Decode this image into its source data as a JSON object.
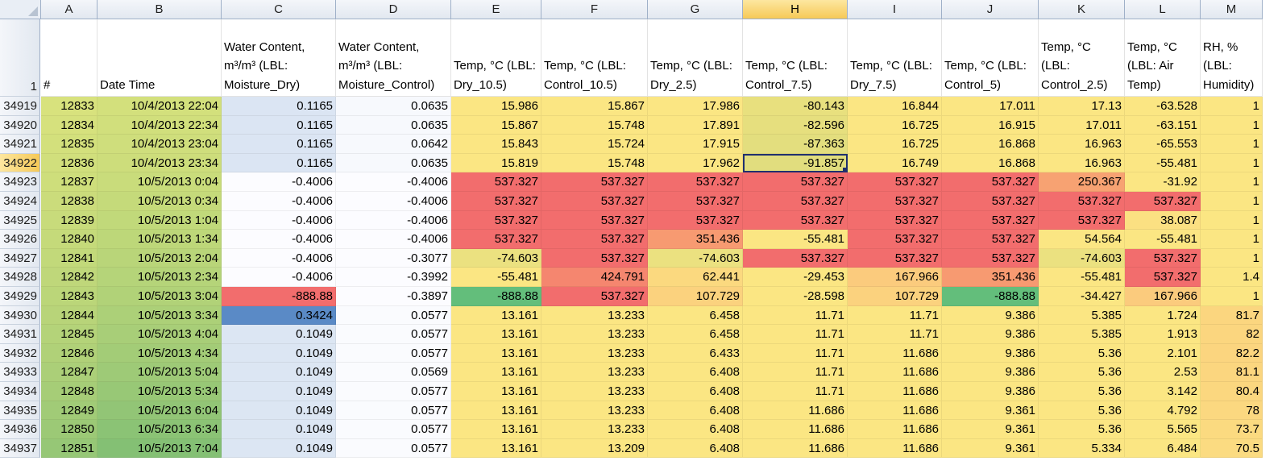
{
  "sheet": {
    "columns": [
      "A",
      "B",
      "C",
      "D",
      "E",
      "F",
      "G",
      "H",
      "I",
      "J",
      "K",
      "L",
      "M"
    ],
    "selected_column": "H",
    "selected_row": "34922",
    "header_row": {
      "row_label": "1",
      "labels": [
        "#",
        "Date Time",
        "Water Content,\nm³/m³ (LBL:\nMoisture_Dry)",
        "Water Content,\nm³/m³ (LBL:\nMoisture_Control)",
        "Temp, °C (LBL:\nDry_10.5)",
        "Temp, °C (LBL:\nControl_10.5)",
        "Temp, °C (LBL:\nDry_2.5)",
        "Temp, °C (LBL:\nControl_7.5)",
        "Temp, °C (LBL:\nDry_7.5)",
        "Temp, °C (LBL:\nControl_5)",
        "Temp, °C\n(LBL:\nControl_2.5)",
        "Temp, °C\n(LBL: Air\nTemp)",
        "RH, %\n(LBL:\nHumidity)"
      ]
    },
    "rows": [
      {
        "label": "34919",
        "cells": [
          "12833",
          "10/4/2013 22:04",
          "0.1165",
          "0.0635",
          "15.986",
          "15.867",
          "17.986",
          "-80.143",
          "16.844",
          "17.011",
          "17.13",
          "-63.528",
          "1"
        ],
        "colors": [
          "#d8e27d",
          "#d3e07c",
          "#dbe5f3",
          "#f7f9fd",
          "#fbe683",
          "#fbe683",
          "#fbe683",
          "#e8e07e",
          "#fbe683",
          "#fbe683",
          "#fbe683",
          "#fbe683",
          "#fbe683"
        ]
      },
      {
        "label": "34920",
        "cells": [
          "12834",
          "10/4/2013 22:34",
          "0.1165",
          "0.0635",
          "15.867",
          "15.748",
          "17.891",
          "-82.596",
          "16.725",
          "16.915",
          "17.011",
          "-63.151",
          "1"
        ],
        "colors": [
          "#d6e17d",
          "#d1df7c",
          "#dbe5f3",
          "#f7f9fd",
          "#fbe683",
          "#fbe683",
          "#fbe683",
          "#e6df7e",
          "#fbe683",
          "#fbe683",
          "#fbe683",
          "#fbe683",
          "#fbe683"
        ]
      },
      {
        "label": "34921",
        "cells": [
          "12835",
          "10/4/2013 23:04",
          "0.1165",
          "0.0642",
          "15.843",
          "15.724",
          "17.915",
          "-87.363",
          "16.725",
          "16.868",
          "16.963",
          "-65.553",
          "1"
        ],
        "colors": [
          "#d3e07c",
          "#cfde7c",
          "#dbe5f3",
          "#f7f9fd",
          "#fbe683",
          "#fbe683",
          "#fbe683",
          "#e3de7e",
          "#fbe683",
          "#fbe683",
          "#fbe683",
          "#fbe683",
          "#fbe683"
        ]
      },
      {
        "label": "34922",
        "cells": [
          "12836",
          "10/4/2013 23:34",
          "0.1165",
          "0.0635",
          "15.819",
          "15.748",
          "17.962",
          "-91.857",
          "16.749",
          "16.868",
          "16.963",
          "-55.481",
          "1"
        ],
        "colors": [
          "#d1df7c",
          "#cddd7b",
          "#dbe5f3",
          "#f7f9fd",
          "#fbe683",
          "#fbe683",
          "#fbe683",
          "#e1dd7e",
          "#fbe683",
          "#fbe683",
          "#fbe683",
          "#fbe683",
          "#fbe683"
        ]
      },
      {
        "label": "34923",
        "cells": [
          "12837",
          "10/5/2013 0:04",
          "-0.4006",
          "-0.4006",
          "537.327",
          "537.327",
          "537.327",
          "537.327",
          "537.327",
          "537.327",
          "250.367",
          "-31.92",
          "1"
        ],
        "colors": [
          "#cede7b",
          "#c9dc7b",
          "#fcfcff",
          "#fcfcff",
          "#f26d6d",
          "#f26d6d",
          "#f26d6d",
          "#f26d6d",
          "#f26d6d",
          "#f26d6d",
          "#f7a272",
          "#fbe683",
          "#fbe683"
        ]
      },
      {
        "label": "34924",
        "cells": [
          "12838",
          "10/5/2013 0:34",
          "-0.4006",
          "-0.4006",
          "537.327",
          "537.327",
          "537.327",
          "537.327",
          "537.327",
          "537.327",
          "537.327",
          "537.327",
          "1"
        ],
        "colors": [
          "#cbdc7b",
          "#c5da7a",
          "#fcfcff",
          "#fcfcff",
          "#f26d6d",
          "#f26d6d",
          "#f26d6d",
          "#f26d6d",
          "#f26d6d",
          "#f26d6d",
          "#f26d6d",
          "#f26d6d",
          "#fbe683"
        ]
      },
      {
        "label": "34925",
        "cells": [
          "12839",
          "10/5/2013 1:04",
          "-0.4006",
          "-0.4006",
          "537.327",
          "537.327",
          "537.327",
          "537.327",
          "537.327",
          "537.327",
          "537.327",
          "38.087",
          "1"
        ],
        "colors": [
          "#c8db7b",
          "#c1d97a",
          "#fcfcff",
          "#fcfcff",
          "#f26d6d",
          "#f26d6d",
          "#f26d6d",
          "#f26d6d",
          "#f26d6d",
          "#f26d6d",
          "#f26d6d",
          "#fbe082",
          "#fbe683"
        ]
      },
      {
        "label": "34926",
        "cells": [
          "12840",
          "10/5/2013 1:34",
          "-0.4006",
          "-0.4006",
          "537.327",
          "537.327",
          "351.436",
          "-55.481",
          "537.327",
          "537.327",
          "54.564",
          "-55.481",
          "1"
        ],
        "colors": [
          "#c5da7a",
          "#bdd779",
          "#fcfcff",
          "#fcfcff",
          "#f26d6d",
          "#f26d6d",
          "#f79a71",
          "#fbe683",
          "#f26d6d",
          "#f26d6d",
          "#fbe683",
          "#fbe683",
          "#fbe683"
        ]
      },
      {
        "label": "34927",
        "cells": [
          "12841",
          "10/5/2013 2:04",
          "-0.4006",
          "-0.3077",
          "-74.603",
          "537.327",
          "-74.603",
          "537.327",
          "537.327",
          "537.327",
          "-74.603",
          "537.327",
          "1"
        ],
        "colors": [
          "#c2d97a",
          "#b9d579",
          "#fcfcff",
          "#fcfcff",
          "#ebe180",
          "#f26d6d",
          "#ebe180",
          "#f26d6d",
          "#f26d6d",
          "#f26d6d",
          "#ebe180",
          "#f26d6d",
          "#fbe683"
        ]
      },
      {
        "label": "34928",
        "cells": [
          "12842",
          "10/5/2013 2:34",
          "-0.4006",
          "-0.3992",
          "-55.481",
          "424.791",
          "62.441",
          "-29.453",
          "167.966",
          "351.436",
          "-55.481",
          "537.327",
          "1.4"
        ],
        "colors": [
          "#bfd77a",
          "#b5d479",
          "#fcfcff",
          "#fcfcff",
          "#fbe683",
          "#f5866f",
          "#fbd97f",
          "#fbe683",
          "#fbcb7d",
          "#f79a71",
          "#fbe683",
          "#f26d6d",
          "#fbe683"
        ]
      },
      {
        "label": "34929",
        "cells": [
          "12843",
          "10/5/2013 3:04",
          "-888.88",
          "-0.3897",
          "-888.88",
          "537.327",
          "107.729",
          "-28.598",
          "107.729",
          "-888.88",
          "-34.427",
          "167.966",
          "1"
        ],
        "colors": [
          "#bbd679",
          "#b1d278",
          "#f26d6d",
          "#fcfcff",
          "#63be7b",
          "#f26d6d",
          "#fbd27e",
          "#fbe683",
          "#fbd27e",
          "#63be7b",
          "#fbe683",
          "#fbcb7d",
          "#fbe683"
        ]
      },
      {
        "label": "34930",
        "cells": [
          "12844",
          "10/5/2013 3:34",
          "0.3424",
          "0.0577",
          "13.161",
          "13.233",
          "6.458",
          "11.71",
          "11.71",
          "9.386",
          "5.385",
          "1.724",
          "81.7"
        ],
        "colors": [
          "#b8d479",
          "#acd078",
          "#5a8ac6",
          "#fafbfe",
          "#fbe683",
          "#fbe683",
          "#fbe683",
          "#fbe683",
          "#fbe683",
          "#fbe683",
          "#fbe683",
          "#fbe683",
          "#fbd67f"
        ]
      },
      {
        "label": "34931",
        "cells": [
          "12845",
          "10/5/2013 4:04",
          "0.1049",
          "0.0577",
          "13.161",
          "13.233",
          "6.458",
          "11.71",
          "11.71",
          "9.386",
          "5.385",
          "1.913",
          "82"
        ],
        "colors": [
          "#b4d379",
          "#a8ce78",
          "#dce6f3",
          "#fafbfe",
          "#fbe683",
          "#fbe683",
          "#fbe683",
          "#fbe683",
          "#fbe683",
          "#fbe683",
          "#fbe683",
          "#fbe683",
          "#fbd67f"
        ]
      },
      {
        "label": "34932",
        "cells": [
          "12846",
          "10/5/2013 4:34",
          "0.1049",
          "0.0577",
          "13.161",
          "13.233",
          "6.433",
          "11.71",
          "11.686",
          "9.386",
          "5.36",
          "2.101",
          "82.2"
        ],
        "colors": [
          "#b0d178",
          "#a3cc77",
          "#dce6f3",
          "#fafbfe",
          "#fbe683",
          "#fbe683",
          "#fbe683",
          "#fbe683",
          "#fbe683",
          "#fbe683",
          "#fbe683",
          "#fbe683",
          "#fbd57f"
        ]
      },
      {
        "label": "34933",
        "cells": [
          "12847",
          "10/5/2013 5:04",
          "0.1049",
          "0.0569",
          "13.161",
          "13.233",
          "6.408",
          "11.71",
          "11.686",
          "9.386",
          "5.36",
          "2.53",
          "81.1"
        ],
        "colors": [
          "#abcf78",
          "#9eca77",
          "#dce6f3",
          "#fafbfe",
          "#fbe683",
          "#fbe683",
          "#fbe683",
          "#fbe683",
          "#fbe683",
          "#fbe683",
          "#fbe683",
          "#fbe683",
          "#fbd67f"
        ]
      },
      {
        "label": "34934",
        "cells": [
          "12848",
          "10/5/2013 5:34",
          "0.1049",
          "0.0577",
          "13.161",
          "13.233",
          "6.408",
          "11.71",
          "11.686",
          "9.386",
          "5.36",
          "3.142",
          "80.4"
        ],
        "colors": [
          "#a6cd77",
          "#98c876",
          "#dce6f3",
          "#fafbfe",
          "#fbe683",
          "#fbe683",
          "#fbe683",
          "#fbe683",
          "#fbe683",
          "#fbe683",
          "#fbe683",
          "#fbe683",
          "#fbd77f"
        ]
      },
      {
        "label": "34935",
        "cells": [
          "12849",
          "10/5/2013 6:04",
          "0.1049",
          "0.0577",
          "13.161",
          "13.233",
          "6.408",
          "11.686",
          "11.686",
          "9.361",
          "5.36",
          "4.792",
          "78"
        ],
        "colors": [
          "#a1cb77",
          "#92c576",
          "#dce6f3",
          "#fafbfe",
          "#fbe683",
          "#fbe683",
          "#fbe683",
          "#fbe683",
          "#fbe683",
          "#fbe683",
          "#fbe683",
          "#fbe683",
          "#fbd880"
        ]
      },
      {
        "label": "34936",
        "cells": [
          "12850",
          "10/5/2013 6:34",
          "0.1049",
          "0.0577",
          "13.161",
          "13.233",
          "6.408",
          "11.686",
          "11.686",
          "9.361",
          "5.36",
          "5.565",
          "73.7"
        ],
        "colors": [
          "#9cc976",
          "#8bc375",
          "#dce6f3",
          "#fafbfe",
          "#fbe683",
          "#fbe683",
          "#fbe683",
          "#fbe683",
          "#fbe683",
          "#fbe683",
          "#fbe683",
          "#fbe683",
          "#fbda80"
        ]
      },
      {
        "label": "34937",
        "cells": [
          "12851",
          "10/5/2013 7:04",
          "0.1049",
          "0.0577",
          "13.161",
          "13.209",
          "6.408",
          "11.686",
          "11.686",
          "9.361",
          "5.334",
          "6.484",
          "70.5"
        ],
        "colors": [
          "#96c776",
          "#84c074",
          "#dce6f3",
          "#fafbfe",
          "#fbe683",
          "#fbe683",
          "#fbe683",
          "#fbe683",
          "#fbe683",
          "#fbe683",
          "#fbe683",
          "#fbe683",
          "#fbdb81"
        ]
      }
    ],
    "active_cell": {
      "row": "34922",
      "column": "H"
    }
  }
}
